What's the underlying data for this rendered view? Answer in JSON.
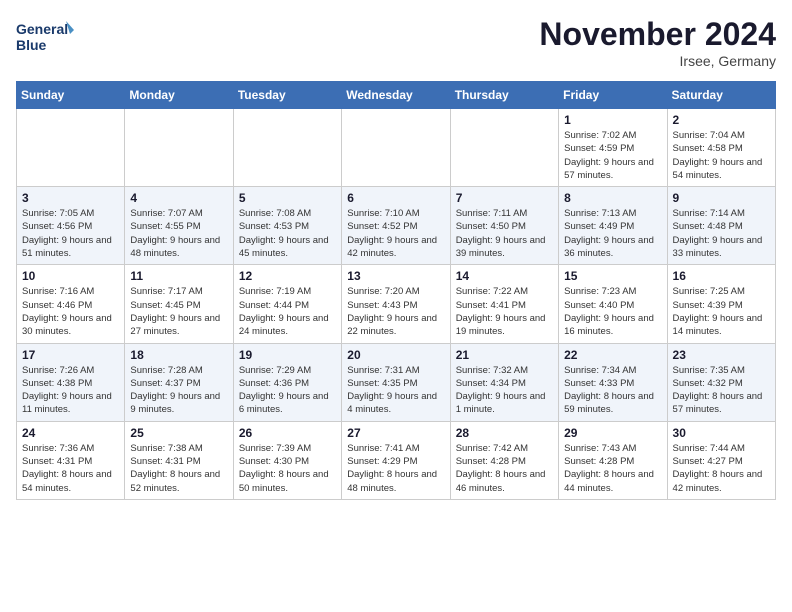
{
  "header": {
    "logo_line1": "General",
    "logo_line2": "Blue",
    "month": "November 2024",
    "location": "Irsee, Germany"
  },
  "weekdays": [
    "Sunday",
    "Monday",
    "Tuesday",
    "Wednesday",
    "Thursday",
    "Friday",
    "Saturday"
  ],
  "rows": [
    [
      {
        "day": "",
        "info": ""
      },
      {
        "day": "",
        "info": ""
      },
      {
        "day": "",
        "info": ""
      },
      {
        "day": "",
        "info": ""
      },
      {
        "day": "",
        "info": ""
      },
      {
        "day": "1",
        "info": "Sunrise: 7:02 AM\nSunset: 4:59 PM\nDaylight: 9 hours and 57 minutes."
      },
      {
        "day": "2",
        "info": "Sunrise: 7:04 AM\nSunset: 4:58 PM\nDaylight: 9 hours and 54 minutes."
      }
    ],
    [
      {
        "day": "3",
        "info": "Sunrise: 7:05 AM\nSunset: 4:56 PM\nDaylight: 9 hours and 51 minutes."
      },
      {
        "day": "4",
        "info": "Sunrise: 7:07 AM\nSunset: 4:55 PM\nDaylight: 9 hours and 48 minutes."
      },
      {
        "day": "5",
        "info": "Sunrise: 7:08 AM\nSunset: 4:53 PM\nDaylight: 9 hours and 45 minutes."
      },
      {
        "day": "6",
        "info": "Sunrise: 7:10 AM\nSunset: 4:52 PM\nDaylight: 9 hours and 42 minutes."
      },
      {
        "day": "7",
        "info": "Sunrise: 7:11 AM\nSunset: 4:50 PM\nDaylight: 9 hours and 39 minutes."
      },
      {
        "day": "8",
        "info": "Sunrise: 7:13 AM\nSunset: 4:49 PM\nDaylight: 9 hours and 36 minutes."
      },
      {
        "day": "9",
        "info": "Sunrise: 7:14 AM\nSunset: 4:48 PM\nDaylight: 9 hours and 33 minutes."
      }
    ],
    [
      {
        "day": "10",
        "info": "Sunrise: 7:16 AM\nSunset: 4:46 PM\nDaylight: 9 hours and 30 minutes."
      },
      {
        "day": "11",
        "info": "Sunrise: 7:17 AM\nSunset: 4:45 PM\nDaylight: 9 hours and 27 minutes."
      },
      {
        "day": "12",
        "info": "Sunrise: 7:19 AM\nSunset: 4:44 PM\nDaylight: 9 hours and 24 minutes."
      },
      {
        "day": "13",
        "info": "Sunrise: 7:20 AM\nSunset: 4:43 PM\nDaylight: 9 hours and 22 minutes."
      },
      {
        "day": "14",
        "info": "Sunrise: 7:22 AM\nSunset: 4:41 PM\nDaylight: 9 hours and 19 minutes."
      },
      {
        "day": "15",
        "info": "Sunrise: 7:23 AM\nSunset: 4:40 PM\nDaylight: 9 hours and 16 minutes."
      },
      {
        "day": "16",
        "info": "Sunrise: 7:25 AM\nSunset: 4:39 PM\nDaylight: 9 hours and 14 minutes."
      }
    ],
    [
      {
        "day": "17",
        "info": "Sunrise: 7:26 AM\nSunset: 4:38 PM\nDaylight: 9 hours and 11 minutes."
      },
      {
        "day": "18",
        "info": "Sunrise: 7:28 AM\nSunset: 4:37 PM\nDaylight: 9 hours and 9 minutes."
      },
      {
        "day": "19",
        "info": "Sunrise: 7:29 AM\nSunset: 4:36 PM\nDaylight: 9 hours and 6 minutes."
      },
      {
        "day": "20",
        "info": "Sunrise: 7:31 AM\nSunset: 4:35 PM\nDaylight: 9 hours and 4 minutes."
      },
      {
        "day": "21",
        "info": "Sunrise: 7:32 AM\nSunset: 4:34 PM\nDaylight: 9 hours and 1 minute."
      },
      {
        "day": "22",
        "info": "Sunrise: 7:34 AM\nSunset: 4:33 PM\nDaylight: 8 hours and 59 minutes."
      },
      {
        "day": "23",
        "info": "Sunrise: 7:35 AM\nSunset: 4:32 PM\nDaylight: 8 hours and 57 minutes."
      }
    ],
    [
      {
        "day": "24",
        "info": "Sunrise: 7:36 AM\nSunset: 4:31 PM\nDaylight: 8 hours and 54 minutes."
      },
      {
        "day": "25",
        "info": "Sunrise: 7:38 AM\nSunset: 4:31 PM\nDaylight: 8 hours and 52 minutes."
      },
      {
        "day": "26",
        "info": "Sunrise: 7:39 AM\nSunset: 4:30 PM\nDaylight: 8 hours and 50 minutes."
      },
      {
        "day": "27",
        "info": "Sunrise: 7:41 AM\nSunset: 4:29 PM\nDaylight: 8 hours and 48 minutes."
      },
      {
        "day": "28",
        "info": "Sunrise: 7:42 AM\nSunset: 4:28 PM\nDaylight: 8 hours and 46 minutes."
      },
      {
        "day": "29",
        "info": "Sunrise: 7:43 AM\nSunset: 4:28 PM\nDaylight: 8 hours and 44 minutes."
      },
      {
        "day": "30",
        "info": "Sunrise: 7:44 AM\nSunset: 4:27 PM\nDaylight: 8 hours and 42 minutes."
      }
    ]
  ]
}
